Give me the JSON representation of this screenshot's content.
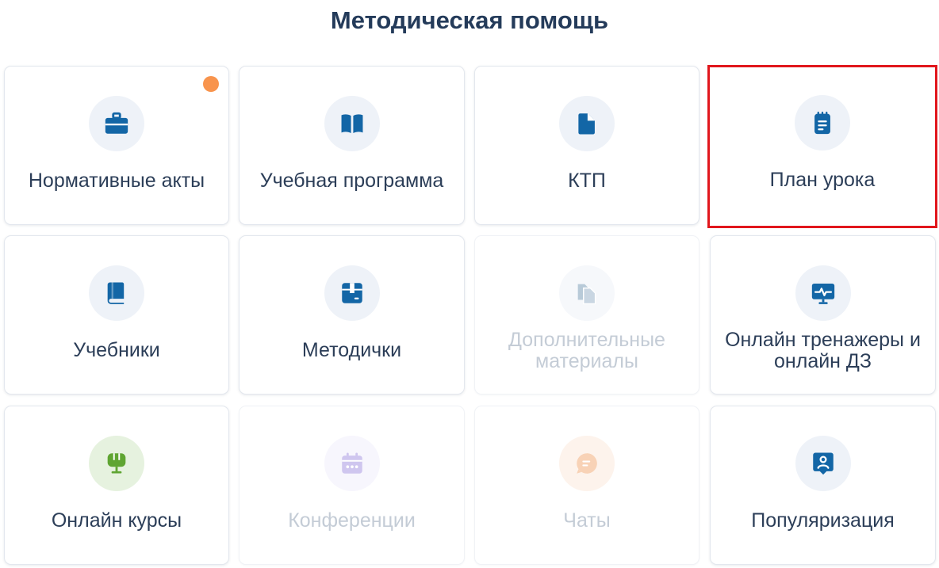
{
  "page": {
    "title": "Методическая помощь"
  },
  "colors": {
    "accent": "#1366a6",
    "selected_border": "#e1161c",
    "badge": "#f8944d",
    "text": "#2c3e58",
    "text_disabled": "#c4ccd6"
  },
  "cards": [
    {
      "label": "Нормативные акты",
      "icon": "briefcase-icon",
      "state": "enabled",
      "badge": true
    },
    {
      "label": "Учебная программа",
      "icon": "open-book-icon",
      "state": "enabled"
    },
    {
      "label": "КТП",
      "icon": "document-icon",
      "state": "enabled"
    },
    {
      "label": "План урока",
      "icon": "notepad-icon",
      "state": "selected"
    },
    {
      "label": "Учебники",
      "icon": "textbook-icon",
      "state": "enabled"
    },
    {
      "label": "Методички",
      "icon": "package-icon",
      "state": "enabled"
    },
    {
      "label": "Дополнительные материалы",
      "icon": "copy-documents-icon",
      "state": "disabled"
    },
    {
      "label": "Онлайн тренажеры и онлайн ДЗ",
      "icon": "monitor-activity-icon",
      "state": "enabled"
    },
    {
      "label": "Онлайн курсы",
      "icon": "microphone-icon",
      "state": "enabled"
    },
    {
      "label": "Конференции",
      "icon": "calendar-icon",
      "state": "disabled"
    },
    {
      "label": "Чаты",
      "icon": "chat-bubble-icon",
      "state": "disabled"
    },
    {
      "label": "Популяризация",
      "icon": "user-badge-icon",
      "state": "enabled"
    }
  ]
}
